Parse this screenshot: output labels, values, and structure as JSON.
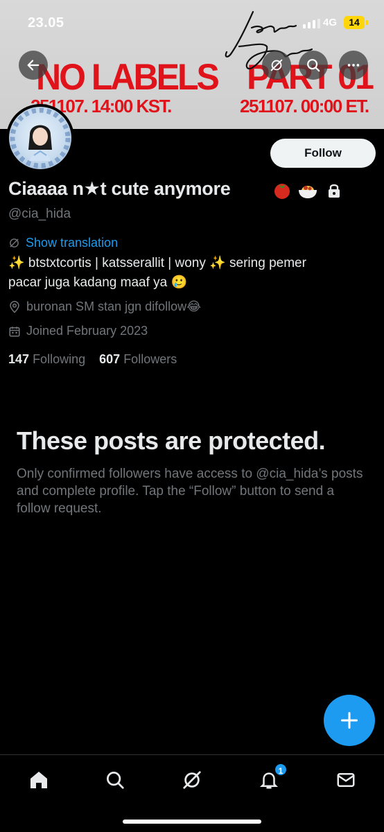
{
  "status_bar": {
    "time": "23.05",
    "network": "4G",
    "battery": "14"
  },
  "banner": {
    "left_title": "NO LABELS",
    "left_subtitle": "251107. 14:00 KST.",
    "right_title": "PART 01",
    "right_subtitle": "251107. 00:00 ET."
  },
  "profile": {
    "follow_label": "Follow",
    "display_name": "Ciaaaa n★t cute anymore",
    "handle": "@cia_hida",
    "show_translation": "Show translation",
    "bio_line1": "✨ btstxtcortis | katsserallit | wony ✨ sering pemer",
    "bio_line2": "pacar juga kadang maaf ya 🥲",
    "location": "buronan SM stan jgn difollow😂",
    "joined": "Joined February 2023",
    "following_count": "147",
    "following_label": "Following",
    "followers_count": "607",
    "followers_label": "Followers"
  },
  "protected": {
    "title": "These posts are protected.",
    "body": "Only confirmed followers have access to @cia_hida’s posts and complete profile. Tap the “Follow” button to send a follow request."
  },
  "tabbar": {
    "items": [
      "home-icon",
      "search-icon",
      "grok-icon",
      "notifications-icon",
      "messages-icon"
    ],
    "notification_badge": "1"
  },
  "colors": {
    "accent": "#1d9bf0",
    "banner_red": "#e0131b",
    "muted": "#71767b"
  }
}
